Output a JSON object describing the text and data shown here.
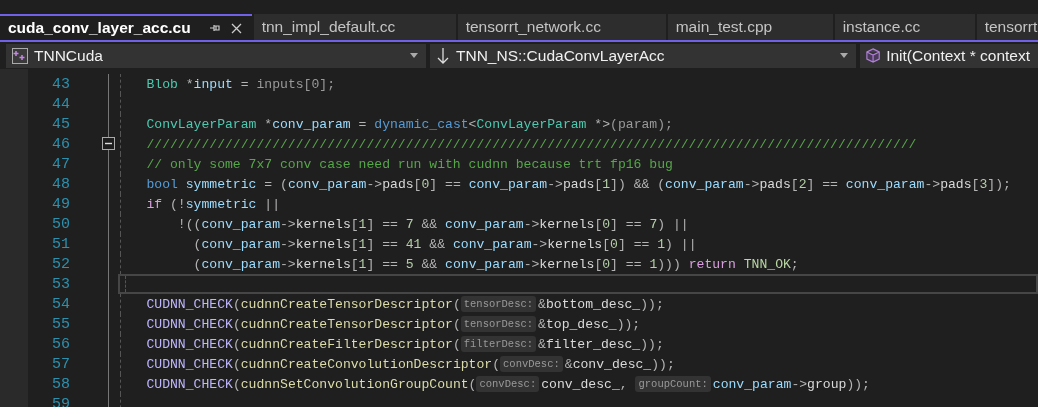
{
  "tabs": [
    {
      "label": "cuda_conv_layer_acc.cu",
      "selected": true
    },
    {
      "label": "tnn_impl_default.cc",
      "selected": false
    },
    {
      "label": "tensorrt_network.cc",
      "selected": false
    },
    {
      "label": "main_test.cpp",
      "selected": false
    },
    {
      "label": "instance.cc",
      "selected": false
    },
    {
      "label": "tensorrt",
      "selected": false
    }
  ],
  "navigation_bar": [
    {
      "label": "TNNCuda",
      "kind": "project"
    },
    {
      "label": "TNN_NS::CudaConvLayerAcc",
      "kind": "scope"
    },
    {
      "label": "Init(Context * context",
      "kind": "member"
    }
  ],
  "editor": {
    "lines": [
      {
        "number": "43",
        "current": false,
        "tokens": [
          {
            "text": "    Blob",
            "kind": "type"
          },
          {
            "text": " *",
            "kind": "plain"
          },
          {
            "text": "input",
            "kind": "local"
          },
          {
            "text": " = ",
            "kind": "plain"
          },
          {
            "text": "inputs[0];",
            "kind": "param"
          }
        ]
      },
      {
        "number": "44",
        "current": false
      },
      {
        "number": "45",
        "current": false,
        "tokens": [
          {
            "text": "    ConvLayerParam",
            "kind": "type"
          },
          {
            "text": " *",
            "kind": "plain"
          },
          {
            "text": "conv_param",
            "kind": "local"
          },
          {
            "text": " = ",
            "kind": "plain"
          },
          {
            "text": "dynamic_cast",
            "kind": "kw"
          },
          {
            "text": "<",
            "kind": "plain"
          },
          {
            "text": "ConvLayerParam",
            "kind": "type"
          },
          {
            "text": " *>",
            "kind": "plain"
          },
          {
            "text": "(param);",
            "kind": "param"
          }
        ]
      },
      {
        "number": "46",
        "current": false,
        "collapse_toggle": {
          "expanded": true
        },
        "tokens": [
          {
            "text": "    //////////////////////////////////////////////////////////////////////////////////////////////////",
            "kind": "cmt"
          }
        ]
      },
      {
        "number": "47",
        "current": false,
        "tokens": [
          {
            "text": "    // only some 7x7 conv case need run with cudnn because trt fp16 bug",
            "kind": "cmt"
          }
        ]
      },
      {
        "number": "48",
        "current": false,
        "tokens": [
          {
            "text": "    bool ",
            "kind": "kw"
          },
          {
            "text": "symmetric",
            "kind": "local"
          },
          {
            "text": " = (",
            "kind": "plain"
          },
          {
            "text": "conv_param",
            "kind": "local"
          },
          {
            "text": "->",
            "kind": "plain"
          },
          {
            "text": "pads",
            "kind": "field"
          },
          {
            "text": "[",
            "kind": "plain"
          },
          {
            "text": "0",
            "kind": "num"
          },
          {
            "text": "] == ",
            "kind": "plain"
          },
          {
            "text": "conv_param",
            "kind": "local"
          },
          {
            "text": "->",
            "kind": "plain"
          },
          {
            "text": "pads",
            "kind": "field"
          },
          {
            "text": "[",
            "kind": "plain"
          },
          {
            "text": "1",
            "kind": "num"
          },
          {
            "text": "]) && (",
            "kind": "plain"
          },
          {
            "text": "conv_param",
            "kind": "local"
          },
          {
            "text": "->",
            "kind": "plain"
          },
          {
            "text": "pads",
            "kind": "field"
          },
          {
            "text": "[",
            "kind": "plain"
          },
          {
            "text": "2",
            "kind": "num"
          },
          {
            "text": "] == ",
            "kind": "plain"
          },
          {
            "text": "conv_param",
            "kind": "local"
          },
          {
            "text": "->",
            "kind": "plain"
          },
          {
            "text": "pads",
            "kind": "field"
          },
          {
            "text": "[",
            "kind": "plain"
          },
          {
            "text": "3",
            "kind": "num"
          },
          {
            "text": "]);",
            "kind": "plain"
          }
        ]
      },
      {
        "number": "49",
        "current": false,
        "tokens": [
          {
            "text": "    if",
            "kind": "ctrl"
          },
          {
            "text": " (!",
            "kind": "plain"
          },
          {
            "text": "symmetric",
            "kind": "local"
          },
          {
            "text": " ||",
            "kind": "plain"
          }
        ]
      },
      {
        "number": "50",
        "current": false,
        "tokens": [
          {
            "text": "        !((",
            "kind": "plain"
          },
          {
            "text": "conv_param",
            "kind": "local"
          },
          {
            "text": "->",
            "kind": "plain"
          },
          {
            "text": "kernels",
            "kind": "field"
          },
          {
            "text": "[",
            "kind": "plain"
          },
          {
            "text": "1",
            "kind": "num"
          },
          {
            "text": "] == ",
            "kind": "plain"
          },
          {
            "text": "7",
            "kind": "num"
          },
          {
            "text": " && ",
            "kind": "plain"
          },
          {
            "text": "conv_param",
            "kind": "local"
          },
          {
            "text": "->",
            "kind": "plain"
          },
          {
            "text": "kernels",
            "kind": "field"
          },
          {
            "text": "[",
            "kind": "plain"
          },
          {
            "text": "0",
            "kind": "num"
          },
          {
            "text": "] == ",
            "kind": "plain"
          },
          {
            "text": "7",
            "kind": "num"
          },
          {
            "text": ") ||",
            "kind": "plain"
          }
        ]
      },
      {
        "number": "51",
        "current": false,
        "tokens": [
          {
            "text": "          (",
            "kind": "plain"
          },
          {
            "text": "conv_param",
            "kind": "local"
          },
          {
            "text": "->",
            "kind": "plain"
          },
          {
            "text": "kernels",
            "kind": "field"
          },
          {
            "text": "[",
            "kind": "plain"
          },
          {
            "text": "1",
            "kind": "num"
          },
          {
            "text": "] == ",
            "kind": "plain"
          },
          {
            "text": "41",
            "kind": "num"
          },
          {
            "text": " && ",
            "kind": "plain"
          },
          {
            "text": "conv_param",
            "kind": "local"
          },
          {
            "text": "->",
            "kind": "plain"
          },
          {
            "text": "kernels",
            "kind": "field"
          },
          {
            "text": "[",
            "kind": "plain"
          },
          {
            "text": "0",
            "kind": "num"
          },
          {
            "text": "] == ",
            "kind": "plain"
          },
          {
            "text": "1",
            "kind": "num"
          },
          {
            "text": ") ||",
            "kind": "plain"
          }
        ]
      },
      {
        "number": "52",
        "current": false,
        "tokens": [
          {
            "text": "          (",
            "kind": "plain"
          },
          {
            "text": "conv_param",
            "kind": "local"
          },
          {
            "text": "->",
            "kind": "plain"
          },
          {
            "text": "kernels",
            "kind": "field"
          },
          {
            "text": "[",
            "kind": "plain"
          },
          {
            "text": "1",
            "kind": "num"
          },
          {
            "text": "] == ",
            "kind": "plain"
          },
          {
            "text": "5",
            "kind": "num"
          },
          {
            "text": " && ",
            "kind": "plain"
          },
          {
            "text": "conv_param",
            "kind": "local"
          },
          {
            "text": "->",
            "kind": "plain"
          },
          {
            "text": "kernels",
            "kind": "field"
          },
          {
            "text": "[",
            "kind": "plain"
          },
          {
            "text": "0",
            "kind": "num"
          },
          {
            "text": "] == ",
            "kind": "plain"
          },
          {
            "text": "1",
            "kind": "num"
          },
          {
            "text": "))) ",
            "kind": "plain"
          },
          {
            "text": "return ",
            "kind": "ctrl"
          },
          {
            "text": "TNN_OK",
            "kind": "enum"
          },
          {
            "text": ";",
            "kind": "plain"
          }
        ]
      },
      {
        "number": "53",
        "current": true
      },
      {
        "number": "54",
        "current": false,
        "tokens": [
          {
            "text": "    CUDNN_CHECK",
            "kind": "macro"
          },
          {
            "text": "(",
            "kind": "plain"
          },
          {
            "text": "cudnnCreateTensorDescriptor",
            "kind": "fn"
          },
          {
            "text": "(",
            "kind": "plain"
          },
          {
            "text": "tensorDesc:",
            "kind": "hint"
          },
          {
            "text": "&",
            "kind": "plain"
          },
          {
            "text": "bottom_desc_",
            "kind": "field"
          },
          {
            "text": "));",
            "kind": "plain"
          }
        ]
      },
      {
        "number": "55",
        "current": false,
        "tokens": [
          {
            "text": "    CUDNN_CHECK",
            "kind": "macro"
          },
          {
            "text": "(",
            "kind": "plain"
          },
          {
            "text": "cudnnCreateTensorDescriptor",
            "kind": "fn"
          },
          {
            "text": "(",
            "kind": "plain"
          },
          {
            "text": "tensorDesc:",
            "kind": "hint"
          },
          {
            "text": "&",
            "kind": "plain"
          },
          {
            "text": "top_desc_",
            "kind": "field"
          },
          {
            "text": "));",
            "kind": "plain"
          }
        ]
      },
      {
        "number": "56",
        "current": false,
        "tokens": [
          {
            "text": "    CUDNN_CHECK",
            "kind": "macro"
          },
          {
            "text": "(",
            "kind": "plain"
          },
          {
            "text": "cudnnCreateFilterDescriptor",
            "kind": "fn"
          },
          {
            "text": "(",
            "kind": "plain"
          },
          {
            "text": "filterDesc:",
            "kind": "hint"
          },
          {
            "text": "&",
            "kind": "plain"
          },
          {
            "text": "filter_desc_",
            "kind": "field"
          },
          {
            "text": "));",
            "kind": "plain"
          }
        ]
      },
      {
        "number": "57",
        "current": false,
        "tokens": [
          {
            "text": "    CUDNN_CHECK",
            "kind": "macro"
          },
          {
            "text": "(",
            "kind": "plain"
          },
          {
            "text": "cudnnCreateConvolutionDescriptor",
            "kind": "fn"
          },
          {
            "text": "(",
            "kind": "plain"
          },
          {
            "text": "convDesc:",
            "kind": "hint"
          },
          {
            "text": "&",
            "kind": "plain"
          },
          {
            "text": "conv_desc_",
            "kind": "field"
          },
          {
            "text": "));",
            "kind": "plain"
          }
        ]
      },
      {
        "number": "58",
        "current": false,
        "tokens": [
          {
            "text": "    CUDNN_CHECK",
            "kind": "macro"
          },
          {
            "text": "(",
            "kind": "plain"
          },
          {
            "text": "cudnnSetConvolutionGroupCount",
            "kind": "fn"
          },
          {
            "text": "(",
            "kind": "plain"
          },
          {
            "text": "convDesc:",
            "kind": "hint"
          },
          {
            "text": "conv_desc_",
            "kind": "field"
          },
          {
            "text": ", ",
            "kind": "plain"
          },
          {
            "text": "groupCount:",
            "kind": "hint"
          },
          {
            "text": "conv_param",
            "kind": "local"
          },
          {
            "text": "->",
            "kind": "plain"
          },
          {
            "text": "group",
            "kind": "field"
          },
          {
            "text": "));",
            "kind": "plain"
          }
        ]
      },
      {
        "number": "59",
        "current": false
      }
    ]
  }
}
